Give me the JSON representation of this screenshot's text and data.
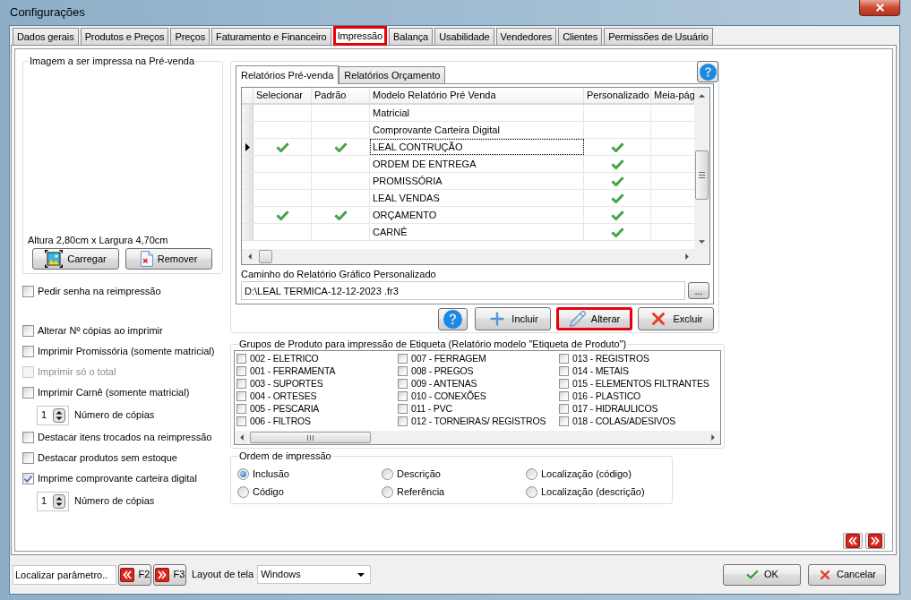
{
  "window": {
    "title": "Configurações"
  },
  "tabs": [
    {
      "label": "Dados gerais",
      "selected": false,
      "highlighted": false
    },
    {
      "label": "Produtos e Preços",
      "selected": false,
      "highlighted": false
    },
    {
      "label": "Preços",
      "selected": false,
      "highlighted": false
    },
    {
      "label": "Faturamento e Financeiro",
      "selected": false,
      "highlighted": false
    },
    {
      "label": "Impressão",
      "selected": true,
      "highlighted": true
    },
    {
      "label": "Balança",
      "selected": false,
      "highlighted": false
    },
    {
      "label": "Usabilidade",
      "selected": false,
      "highlighted": false
    },
    {
      "label": "Vendedores",
      "selected": false,
      "highlighted": false
    },
    {
      "label": "Clientes",
      "selected": false,
      "highlighted": false
    },
    {
      "label": "Permissões de Usuário",
      "selected": false,
      "highlighted": false
    }
  ],
  "image_group": {
    "title": "Imagem a ser impressa na Pré-venda",
    "dimensions": "Altura 2,80cm x Largura 4,70cm",
    "buttons": [
      {
        "kind": "load",
        "label": "Carregar"
      },
      {
        "kind": "remove",
        "label": "Remover"
      }
    ]
  },
  "password_option": {
    "label": "Pedir senha na reimpressão",
    "checked": false
  },
  "print_options": [
    {
      "kind": "checkbox",
      "label": "Alterar Nº cópias ao imprimir",
      "checked": false,
      "disabled": false
    },
    {
      "kind": "checkbox",
      "label": "Imprimir Promissória (somente matricial)",
      "checked": false,
      "disabled": false
    },
    {
      "kind": "checkbox",
      "label": "Imprimir só o total",
      "checked": false,
      "disabled": true
    },
    {
      "kind": "checkbox",
      "label": "Imprimir Carnê (somente matricial)",
      "checked": false,
      "disabled": false
    },
    {
      "kind": "spinner",
      "value": "1",
      "label": "Número de cópias"
    },
    {
      "kind": "checkbox",
      "label": "Destacar itens trocados na reimpressão",
      "checked": false,
      "disabled": false
    },
    {
      "kind": "checkbox",
      "label": "Destacar produtos sem estoque",
      "checked": false,
      "disabled": false
    },
    {
      "kind": "checkbox",
      "label": "Imprime comprovante carteira digital",
      "checked": true,
      "disabled": false
    },
    {
      "kind": "spinner",
      "value": "1",
      "label": "Número de cópias"
    }
  ],
  "reports": {
    "tabs": [
      {
        "label": "Relatórios Pré-venda",
        "selected": true
      },
      {
        "label": "Relatórios Orçamento",
        "selected": false
      }
    ],
    "columns": [
      "Selecionar",
      "Padrão",
      "Modelo Relatório Pré Venda",
      "Personalizado",
      "Meia-pág"
    ],
    "rows": [
      {
        "current": false,
        "selecionar": false,
        "padrao": false,
        "modelo": "Matricial",
        "personalizado": false
      },
      {
        "current": false,
        "selecionar": false,
        "padrao": false,
        "modelo": "Comprovante Carteira Digital",
        "personalizado": false
      },
      {
        "current": true,
        "selecionar": true,
        "padrao": true,
        "modelo": "LEAL CONTRUÇÃO",
        "personalizado": true
      },
      {
        "current": false,
        "selecionar": false,
        "padrao": false,
        "modelo": "ORDEM DE ENTREGA",
        "personalizado": true
      },
      {
        "current": false,
        "selecionar": false,
        "padrao": false,
        "modelo": "PROMISSÓRIA",
        "personalizado": true
      },
      {
        "current": false,
        "selecionar": false,
        "padrao": false,
        "modelo": "LEAL VENDAS",
        "personalizado": true
      },
      {
        "current": false,
        "selecionar": true,
        "padrao": true,
        "modelo": "ORÇAMENTO",
        "personalizado": true
      },
      {
        "current": false,
        "selecionar": false,
        "padrao": false,
        "modelo": "CARNÊ",
        "personalizado": true
      }
    ],
    "path_label": "Caminho do Relatório Gráfico Personalizado",
    "path": {
      "value": "D:\\LEAL TERMICA-12-12-2023 .fr3"
    },
    "browse_button": "...",
    "actions": [
      {
        "kind": "add",
        "label": "Incluir",
        "highlighted": false
      },
      {
        "kind": "edit",
        "label": "Alterar",
        "highlighted": true
      },
      {
        "kind": "delete",
        "label": "Excluir",
        "highlighted": false
      }
    ]
  },
  "product_groups": {
    "title": "Grupos de Produto para impressão de Etiqueta (Relatório modelo \"Etiqueta de Produto\")",
    "items": [
      {
        "label": "002 - ELETRICO",
        "checked": false
      },
      {
        "label": "001 - FERRAMENTA",
        "checked": false
      },
      {
        "label": "003 - SUPORTES",
        "checked": false
      },
      {
        "label": "004 - ORTESES",
        "checked": false
      },
      {
        "label": "005 - PESCARIA",
        "checked": false
      },
      {
        "label": "006 - FILTROS",
        "checked": false
      },
      {
        "label": "007 - FERRAGEM",
        "checked": false
      },
      {
        "label": "008 - PREGOS",
        "checked": false
      },
      {
        "label": "009 - ANTENAS",
        "checked": false
      },
      {
        "label": "010 - CONEXÕES",
        "checked": false
      },
      {
        "label": "011 - PVC",
        "checked": false
      },
      {
        "label": "012 - TORNEIRAS/ REGISTROS",
        "checked": false
      },
      {
        "label": "013 - REGISTROS",
        "checked": false
      },
      {
        "label": "014 - METAIS",
        "checked": false
      },
      {
        "label": "015 - ELEMENTOS FILTRANTES",
        "checked": false
      },
      {
        "label": "016 - PLASTICO",
        "checked": false
      },
      {
        "label": "017 - HIDRAULICOS",
        "checked": false
      },
      {
        "label": "018 - COLAS/ADESIVOS",
        "checked": false
      }
    ]
  },
  "print_order": {
    "title": "Ordem de impressão",
    "options": [
      {
        "label": "Inclusão",
        "selected": true
      },
      {
        "label": "Descrição",
        "selected": false
      },
      {
        "label": "Localização (código)",
        "selected": false
      },
      {
        "label": "Código",
        "selected": false
      },
      {
        "label": "Referência",
        "selected": false
      },
      {
        "label": "Localização (descrição)",
        "selected": false
      }
    ]
  },
  "footer": {
    "search": {
      "placeholder": "Localizar parâmetro.."
    },
    "prev_button": "F2",
    "next_button": "F3",
    "layout_label": "Layout de tela",
    "layout_select": {
      "value": "Windows"
    },
    "buttons": [
      {
        "kind": "ok",
        "label": "OK"
      },
      {
        "kind": "cancel",
        "label": "Cancelar"
      }
    ]
  }
}
